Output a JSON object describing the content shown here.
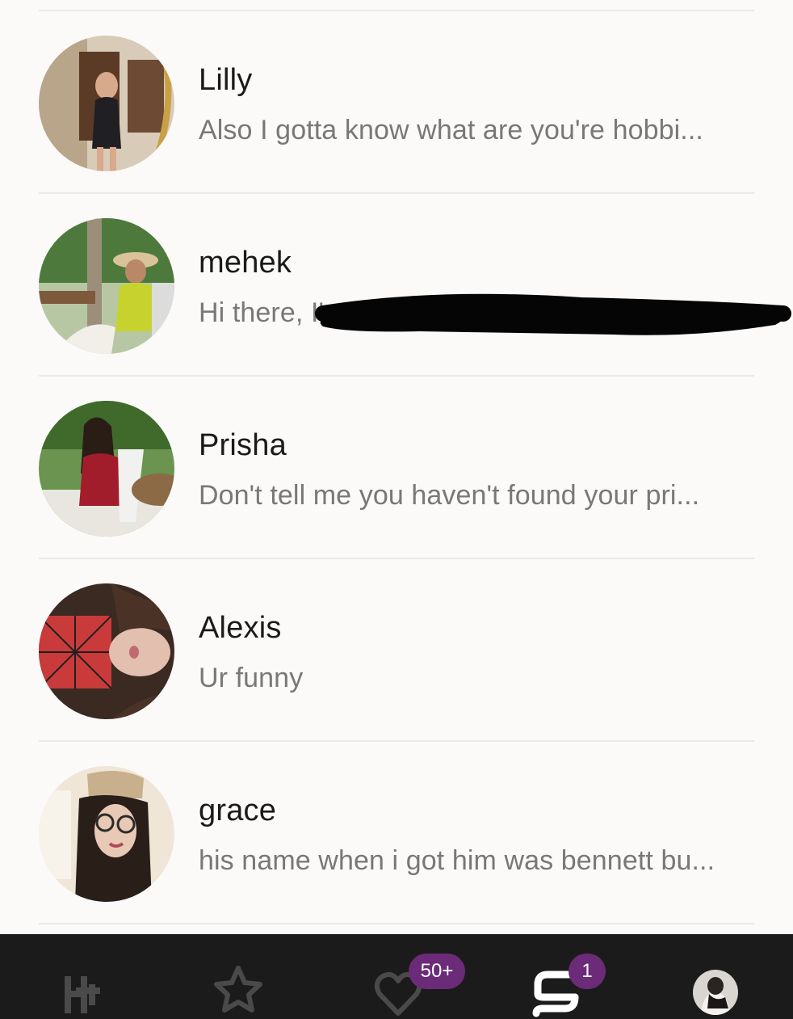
{
  "conversations": [
    {
      "name": "Lilly",
      "preview": "Also I gotta know what are you're hobbi...",
      "avatar_color": "#8a6a52"
    },
    {
      "name": "mehek",
      "preview": "Hi there, I'm pursuing my CS...",
      "avatar_color": "#6f8b58"
    },
    {
      "name": "Prisha",
      "preview": "Don't tell me you haven't found your pri...",
      "avatar_color": "#5d7d44"
    },
    {
      "name": "Alexis",
      "preview": "Ur funny",
      "avatar_color": "#b23a3a"
    },
    {
      "name": "grace",
      "preview": "his name when i got him was bennett bu...",
      "avatar_color": "#c9b49a"
    }
  ],
  "nav": {
    "home_icon": "hinge-logo-icon",
    "standouts_icon": "star-icon",
    "likes_icon": "heart-icon",
    "likes_badge": "50+",
    "matches_icon": "chat-icon",
    "matches_badge": "1",
    "profile_icon": "profile-avatar"
  },
  "colors": {
    "badge": "#6b2b78",
    "nav_bg": "#1c1b1b",
    "divider": "#ebe8e5",
    "preview_text": "#7a7775"
  }
}
